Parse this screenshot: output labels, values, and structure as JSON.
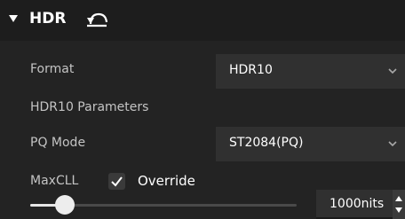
{
  "section": {
    "title": "HDR",
    "caret_icon": "triangle-down-icon",
    "reset_icon": "undo-icon"
  },
  "fields": {
    "format_label": "Format",
    "format_value": "HDR10",
    "params_label": "HDR10 Parameters",
    "pq_label": "PQ Mode",
    "pq_value": "ST2084(PQ)",
    "maxcll_label": "MaxCLL",
    "override_label": "Override",
    "override_checked": true,
    "maxcll_value": "1000nits"
  },
  "colors": {
    "background": "#232323",
    "header_background": "#1d1d1d",
    "dropdown_background": "#303030"
  }
}
